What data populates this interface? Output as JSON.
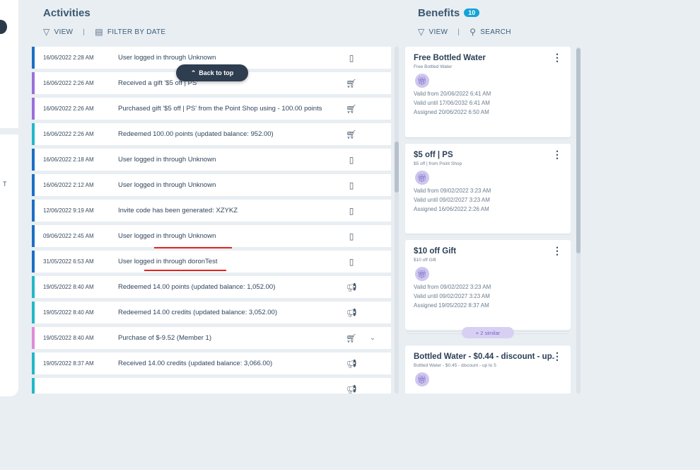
{
  "activities": {
    "title": "Activities",
    "view_label": "VIEW",
    "filter_label": "FILTER BY DATE",
    "back_to_top": "Back to top",
    "rows": [
      {
        "date": "16/06/2022 2:28 AM",
        "text": "User logged in through Unknown",
        "icon": "phone-icon",
        "color": "#1e6fc4"
      },
      {
        "date": "16/06/2022 2:26 AM",
        "text": "Received a gift '$5 off | PS'",
        "icon": "cart-icon",
        "color": "#9b6fdb"
      },
      {
        "date": "16/06/2022 2:26 AM",
        "text": "Purchased gift '$5 off | PS' from the Point Shop using - 100.00 points",
        "icon": "cart-icon",
        "color": "#9b6fdb"
      },
      {
        "date": "16/06/2022 2:26 AM",
        "text": "Redeemed 100.00 points (updated balance: 952.00)",
        "icon": "cart-icon",
        "color": "#23b8c8"
      },
      {
        "date": "16/06/2022 2:18 AM",
        "text": "User logged in through Unknown",
        "icon": "phone-icon",
        "color": "#1e6fc4"
      },
      {
        "date": "16/06/2022 2:12 AM",
        "text": "User logged in through Unknown",
        "icon": "phone-icon",
        "color": "#1e6fc4"
      },
      {
        "date": "12/06/2022 9:19 AM",
        "text": "Invite code has been generated: XZYKZ",
        "icon": "phone-icon",
        "color": "#1e6fc4"
      },
      {
        "date": "09/06/2022 2:45 AM",
        "text": "User logged in through Unknown",
        "icon": "phone-icon",
        "color": "#1e6fc4"
      },
      {
        "date": "31/05/2022 6:53 AM",
        "text": "User logged in through doronTest",
        "icon": "phone-icon",
        "color": "#1e6fc4"
      },
      {
        "date": "19/05/2022 8:40 AM",
        "text": "Redeemed 14.00 points (updated balance: 1,052.00)",
        "icon": "megaphone-icon",
        "color": "#23b8c8"
      },
      {
        "date": "19/05/2022 8:40 AM",
        "text": "Redeemed 14.00 credits (updated balance: 3,052.00)",
        "icon": "megaphone-icon",
        "color": "#23b8c8"
      },
      {
        "date": "19/05/2022 8:40 AM",
        "text": "Purchase of $-9.52 (Member 1)",
        "icon": "cart-icon",
        "color": "#e08ad8",
        "expandable": true
      },
      {
        "date": "19/05/2022 8:37 AM",
        "text": "Received 14.00 credits (updated balance: 3,066.00)",
        "icon": "megaphone-icon",
        "color": "#23b8c8"
      },
      {
        "date": "",
        "text": "",
        "icon": "megaphone-icon",
        "color": "#23b8c8"
      }
    ]
  },
  "benefits": {
    "title": "Benefits",
    "count": "10",
    "view_label": "VIEW",
    "search_label": "SEARCH",
    "similar_label": "+ 2 similar",
    "cards": [
      {
        "title": "Free Bottled Water",
        "subtitle": "Free Bottled Water",
        "valid_from": "Valid from 20/06/2022 6:41 AM",
        "valid_until": "Valid until 17/06/2032 6:41 AM",
        "assigned": "Assigned 20/06/2022 6:50 AM"
      },
      {
        "title": "$5 off | PS",
        "subtitle": "$5 off | from Point Shop",
        "valid_from": "Valid from 09/02/2022 3:23 AM",
        "valid_until": "Valid until 09/02/2027 3:23 AM",
        "assigned": "Assigned 16/06/2022 2:26 AM"
      },
      {
        "title": "$10 off Gift",
        "subtitle": "$10 off Gift",
        "valid_from": "Valid from 09/02/2022 3:23 AM",
        "valid_until": "Valid until 09/02/2027 3:23 AM",
        "assigned": "Assigned 19/05/2022 8:37 AM"
      },
      {
        "title": "Bottled Water - $0.44 - discount - up...",
        "subtitle": "Bottled Water - $0.45 - discount - up to 5",
        "valid_from": "",
        "valid_until": "",
        "assigned": ""
      }
    ]
  },
  "left_panel": {
    "partial_text": "T"
  }
}
